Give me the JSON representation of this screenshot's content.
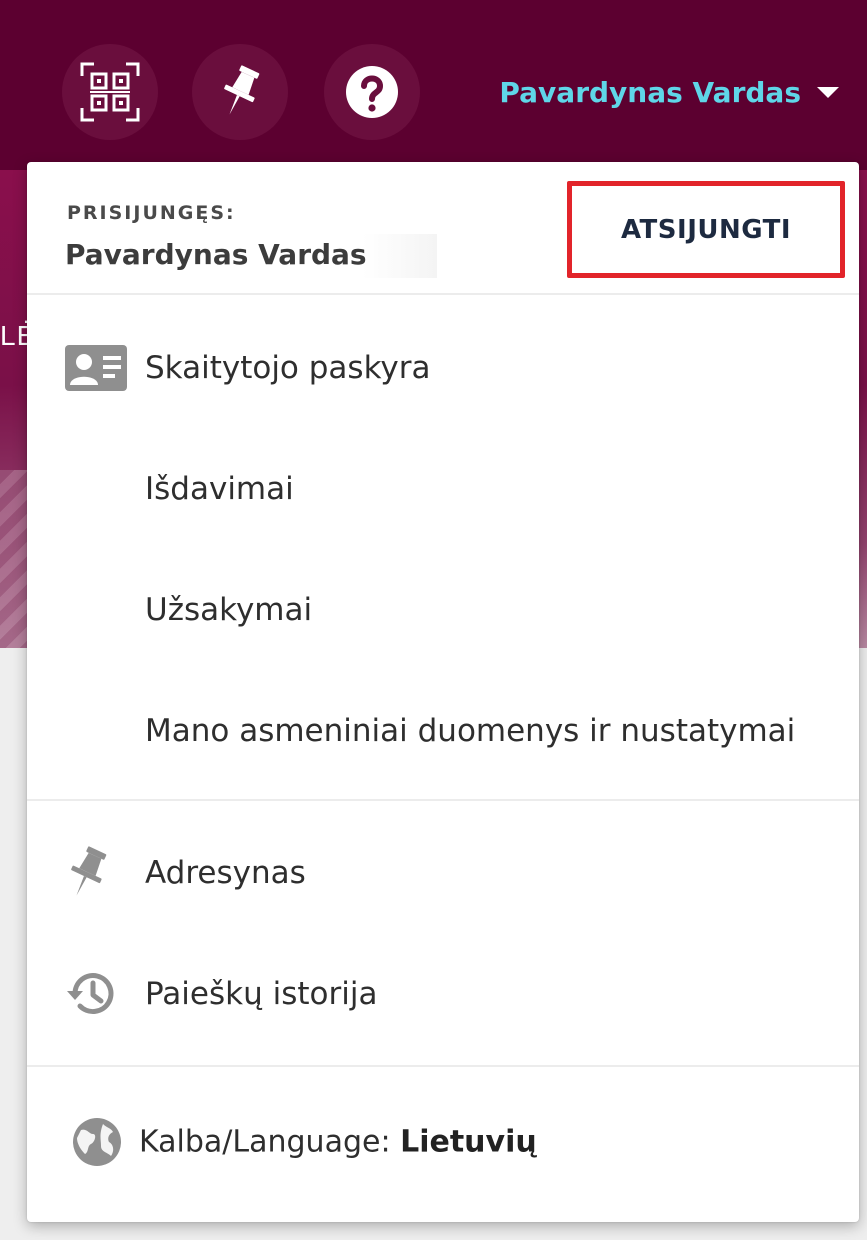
{
  "topbar": {
    "qr_button": "qr-code-icon",
    "pin_button": "pushpin-icon",
    "help_button": "question-circle-icon",
    "user_name": "Pavardynas Vardas"
  },
  "hero": {
    "partial_text": "LĖ"
  },
  "dropdown": {
    "logged_in_label": "PRISIJUNGĘS:",
    "logged_in_name": "Pavardynas Vardas",
    "logout_label": "ATSIJUNGTI",
    "account_items": [
      {
        "label": "Skaitytojo paskyra",
        "icon": "id-card-icon"
      },
      {
        "label": "Išdavimai"
      },
      {
        "label": "Užsakymai"
      },
      {
        "label": "Mano asmeniniai duomenys ir nustatymai"
      }
    ],
    "tool_items": [
      {
        "label": "Adresynas",
        "icon": "pushpin-icon"
      },
      {
        "label": "Paieškų istorija",
        "icon": "history-icon"
      }
    ],
    "language": {
      "prefix": "Kalba/Language: ",
      "value": "Lietuvių",
      "icon": "globe-icon"
    }
  },
  "colors": {
    "topbar_bg": "#5c0030",
    "user_name": "#5fd6e8",
    "highlight_frame": "#e2242a",
    "logout_text": "#1d2a40"
  }
}
